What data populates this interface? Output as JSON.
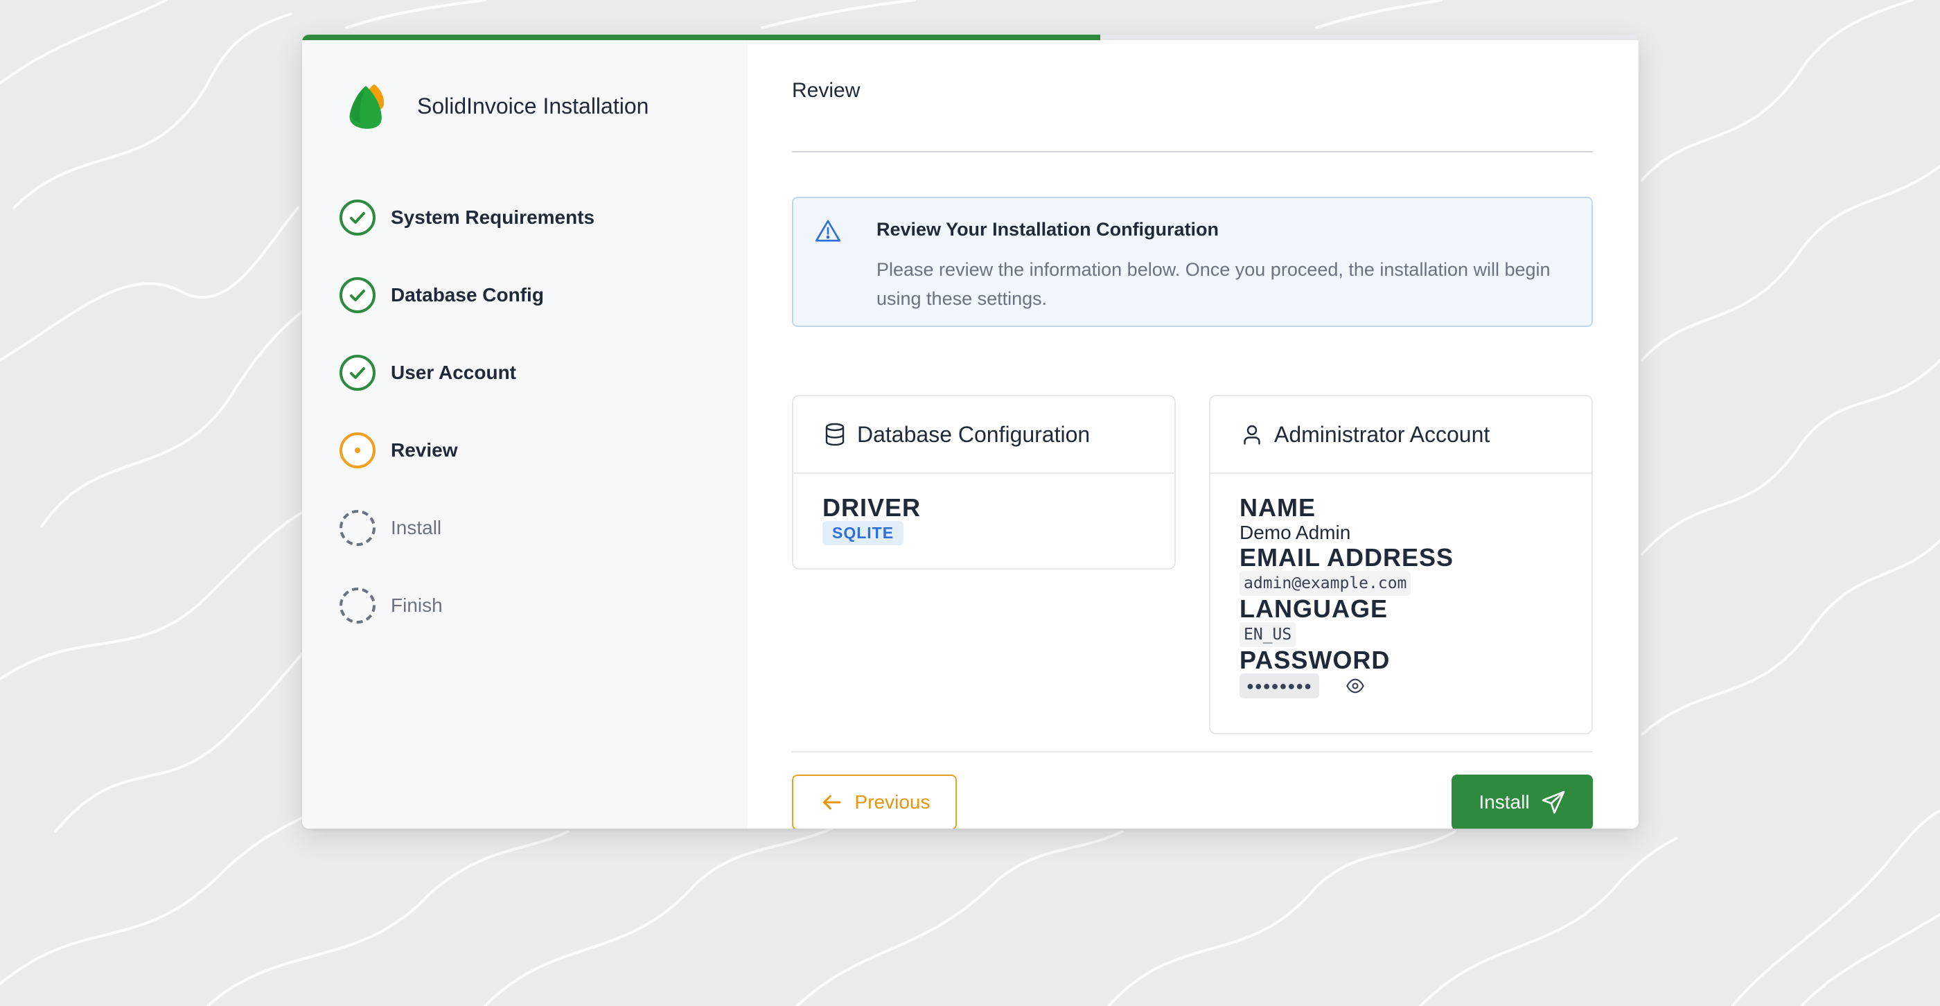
{
  "app": {
    "title": "SolidInvoice Installation"
  },
  "progress": {
    "fraction": 0.597
  },
  "colors": {
    "success": "#2d8a3e",
    "current": "#f0a020",
    "pending": "#6b7280",
    "info_bg": "#f0f6fc",
    "badge_blue": "#2f6fdb"
  },
  "steps": [
    {
      "label": "System Requirements",
      "state": "done",
      "icon": "check-circle-icon"
    },
    {
      "label": "Database Config",
      "state": "done",
      "icon": "check-circle-icon"
    },
    {
      "label": "User Account",
      "state": "done",
      "icon": "check-circle-icon"
    },
    {
      "label": "Review",
      "state": "current",
      "icon": "dot-circle-icon"
    },
    {
      "label": "Install",
      "state": "pending",
      "icon": "dashed-circle-icon"
    },
    {
      "label": "Finish",
      "state": "pending",
      "icon": "dashed-circle-icon"
    }
  ],
  "main": {
    "title": "Review",
    "alert": {
      "icon": "warning-triangle-icon",
      "title": "Review Your Installation Configuration",
      "body": "Please review the information below. Once you proceed, the installation will begin using these settings."
    },
    "database": {
      "icon": "database-icon",
      "title": "Database Configuration",
      "driver_label": "DRIVER",
      "driver_value": "SQLITE"
    },
    "admin": {
      "icon": "user-icon",
      "title": "Administrator Account",
      "name_label": "NAME",
      "name_value": "Demo Admin",
      "email_label": "EMAIL ADDRESS",
      "email_value": "admin@example.com",
      "language_label": "LANGUAGE",
      "language_value": "EN_US",
      "password_label": "PASSWORD",
      "password_value": "●●●●●●●●"
    },
    "buttons": {
      "previous": "Previous",
      "install": "Install"
    }
  }
}
